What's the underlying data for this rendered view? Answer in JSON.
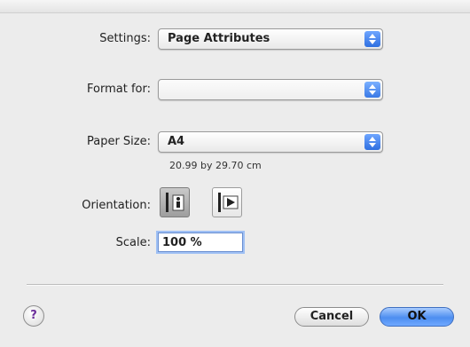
{
  "settings": {
    "label": "Settings:",
    "value": "Page Attributes"
  },
  "format_for": {
    "label": "Format for:",
    "value": ""
  },
  "paper_size": {
    "label": "Paper Size:",
    "value": "A4",
    "dimensions": "20.99 by 29.70 cm"
  },
  "orientation": {
    "label": "Orientation:",
    "options": [
      "portrait",
      "landscape"
    ],
    "selected": "portrait"
  },
  "scale": {
    "label": "Scale:",
    "value": "100 %"
  },
  "buttons": {
    "help": "?",
    "cancel": "Cancel",
    "ok": "OK"
  },
  "colors": {
    "accent": "#2f6fe0",
    "help_glyph": "#6b2d9a"
  }
}
